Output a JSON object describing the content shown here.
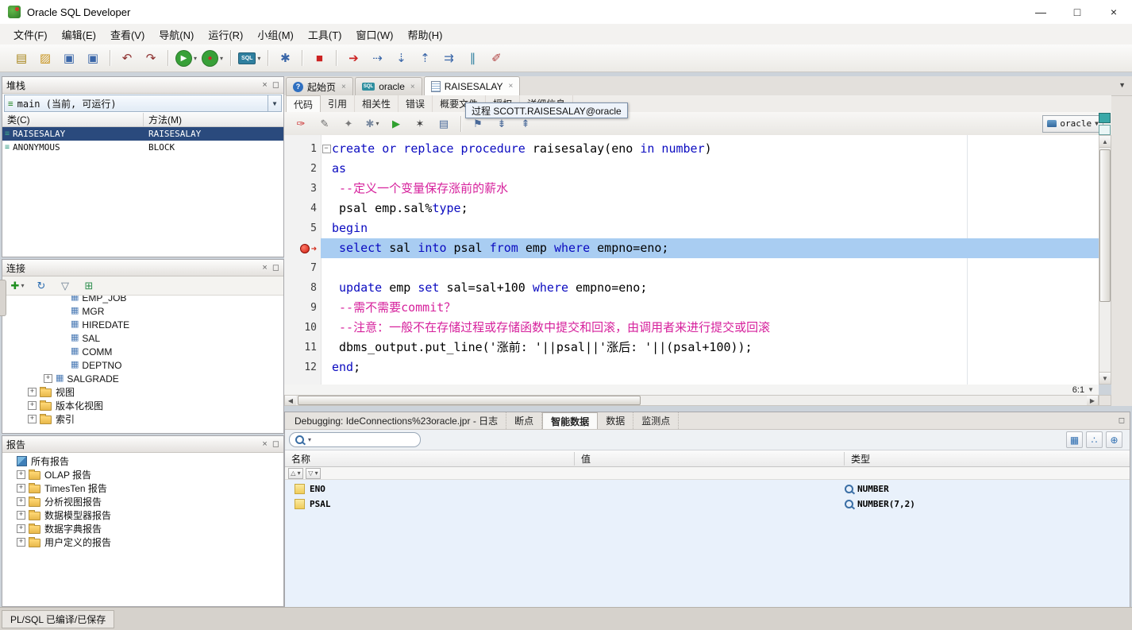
{
  "colors": {
    "selection": "#2a4a7d",
    "line_highlight": "#a9cdf2",
    "breakpoint_red": "#cf1d10",
    "keyword_blue": "#0a0ac0",
    "comment_pink": "#d6219c"
  },
  "window": {
    "title": "Oracle SQL Developer",
    "controls": [
      {
        "name": "minimize-button",
        "glyph": "—"
      },
      {
        "name": "maximize-button",
        "glyph": "□"
      },
      {
        "name": "close-button",
        "glyph": "×"
      }
    ]
  },
  "menu_bar": {
    "items": [
      "文件(F)",
      "编辑(E)",
      "查看(V)",
      "导航(N)",
      "运行(R)",
      "小组(M)",
      "工具(T)",
      "窗口(W)",
      "帮助(H)"
    ]
  },
  "main_toolbar": {
    "buttons": [
      {
        "name": "new-file-button",
        "glyph": "▤",
        "color": "#a8861c"
      },
      {
        "name": "open-button",
        "glyph": "▨",
        "color": "#c8941e"
      },
      {
        "name": "save-button",
        "glyph": "▣",
        "color": "#3a66a8"
      },
      {
        "name": "save-all-button",
        "glyph": "▣",
        "color": "#3a66a8"
      },
      {
        "sep": true
      },
      {
        "name": "undo-button",
        "glyph": "↶",
        "color": "#8d2f2f"
      },
      {
        "name": "redo-button",
        "glyph": "↷",
        "color": "#8d2f2f"
      },
      {
        "sep": true
      },
      {
        "name": "run-button",
        "glyph": "▶",
        "color": "#ffffff",
        "bg": "#38a038",
        "dropdown": true
      },
      {
        "name": "debug-button",
        "glyph": "●",
        "color": "#cc2a2a",
        "bg": "#38a038",
        "dropdown": true
      },
      {
        "sep": true
      },
      {
        "name": "sql-worksheet-button",
        "glyph": "SQL",
        "color": "#ffffff",
        "bg": "#2f7f9f",
        "dropdown": true
      },
      {
        "sep": true
      },
      {
        "name": "gears-icon",
        "glyph": "✱",
        "color": "#3a66a8"
      },
      {
        "sep": true
      },
      {
        "name": "terminate-button",
        "glyph": "■",
        "color": "#cc2222"
      },
      {
        "sep": true
      },
      {
        "name": "find-execution-point-button",
        "glyph": "➔",
        "color": "#cc2222"
      },
      {
        "name": "step-over-button",
        "glyph": "⇢",
        "color": "#3a66a8"
      },
      {
        "name": "step-into-button",
        "glyph": "⇣",
        "color": "#3a66a8"
      },
      {
        "name": "step-out-button",
        "glyph": "⇡",
        "color": "#3a66a8"
      },
      {
        "name": "resume-button",
        "glyph": "⇉",
        "color": "#3a66a8"
      },
      {
        "name": "pause-button",
        "glyph": "∥",
        "color": "#2f7f9f"
      },
      {
        "name": "run-to-cursor-button",
        "glyph": "✐",
        "color": "#b04040"
      }
    ]
  },
  "stack_panel": {
    "title": "堆栈",
    "thread": {
      "label": "main (当前, 可运行)"
    },
    "columns": [
      "类(C)",
      "方法(M)"
    ],
    "rows": [
      {
        "cls": "RAISESALAY",
        "method": "RAISESALAY",
        "selected": true
      },
      {
        "cls": "ANONYMOUS",
        "method": "BLOCK",
        "selected": false
      }
    ]
  },
  "connections_panel": {
    "title": "连接",
    "toolbar": [
      {
        "name": "add-connection-button",
        "glyph": "✚",
        "color": "#1f8f1f",
        "dropdown": true
      },
      {
        "name": "refresh-button",
        "glyph": "↻",
        "color": "#2b6cb0"
      },
      {
        "name": "filter-button",
        "glyph": "▽",
        "color": "#667a8e"
      },
      {
        "name": "collapse-all-button",
        "glyph": "⊞",
        "color": "#2f8f4f"
      }
    ],
    "tree": [
      {
        "label": "EMP_JOB",
        "icon": "column",
        "lvl": 3,
        "cut": true
      },
      {
        "label": "MGR",
        "icon": "column",
        "lvl": 3
      },
      {
        "label": "HIREDATE",
        "icon": "column",
        "lvl": 3
      },
      {
        "label": "SAL",
        "icon": "column",
        "lvl": 3
      },
      {
        "label": "COMM",
        "icon": "column",
        "lvl": 3
      },
      {
        "label": "DEPTNO",
        "icon": "column",
        "lvl": 3
      },
      {
        "label": "SALGRADE",
        "icon": "table",
        "lvl": 2,
        "expand": true
      },
      {
        "label": "视图",
        "icon": "folder",
        "lvl": 1,
        "expand": true
      },
      {
        "label": "版本化视图",
        "icon": "folder",
        "lvl": 1,
        "expand": true
      },
      {
        "label": "索引",
        "icon": "folder",
        "lvl": 1,
        "expand": true
      }
    ]
  },
  "reports_panel": {
    "title": "报告",
    "items": [
      {
        "label": "所有报告",
        "icon": "report",
        "expand": false
      },
      {
        "label": "OLAP 报告",
        "icon": "folder",
        "expand": true
      },
      {
        "label": "TimesTen 报告",
        "icon": "folder",
        "expand": true
      },
      {
        "label": "分析视图报告",
        "icon": "folder",
        "expand": true
      },
      {
        "label": "数据模型器报告",
        "icon": "folder",
        "expand": true
      },
      {
        "label": "数据字典报告",
        "icon": "folder",
        "expand": true
      },
      {
        "label": "用户定义的报告",
        "icon": "folder",
        "expand": true
      }
    ]
  },
  "editor": {
    "doc_tabs": [
      {
        "label": "起始页",
        "icon": "help",
        "active": false
      },
      {
        "label": "oracle",
        "icon": "sql",
        "active": false
      },
      {
        "label": "RAISESALAY",
        "icon": "file",
        "active": true
      }
    ],
    "sub_tabs": [
      {
        "label": "代码",
        "active": true
      },
      {
        "label": "引用",
        "active": false
      },
      {
        "label": "相关性",
        "active": false
      },
      {
        "label": "错误",
        "active": false
      },
      {
        "label": "概要文件",
        "active": false
      },
      {
        "label": "授权",
        "active": false
      },
      {
        "label": "详细信息",
        "active": false
      }
    ],
    "tooltip": "过程 SCOTT.RAISESALAY@oracle",
    "toolbar": {
      "buttons": [
        {
          "name": "debug-needle-icon",
          "glyph": "✑",
          "color": "#cc3333"
        },
        {
          "name": "edit-icon",
          "glyph": "✎",
          "color": "#6b6b6b"
        },
        {
          "name": "compile-icon",
          "glyph": "✦",
          "color": "#7a7a7a"
        },
        {
          "name": "compile-options-button",
          "glyph": "✱",
          "color": "#7a8aa0",
          "dropdown": true
        },
        {
          "name": "run-icon",
          "glyph": "▶",
          "color": "#2fa02f"
        },
        {
          "name": "debug-icon",
          "glyph": "✶",
          "color": "#404040"
        },
        {
          "name": "profile-icon",
          "glyph": "▤",
          "color": "#4a6a9a"
        },
        {
          "sep": true
        },
        {
          "name": "bookmark-icon",
          "glyph": "⚑",
          "color": "#4a6a9a"
        },
        {
          "name": "next-bookmark-icon",
          "glyph": "⇟",
          "color": "#4a6a9a"
        },
        {
          "name": "prev-bookmark-icon",
          "glyph": "⇞",
          "color": "#4a6a9a"
        }
      ],
      "connection": {
        "label": "oracle"
      }
    },
    "position": "6:1",
    "code": {
      "lines": [
        {
          "n": 1,
          "fold": true,
          "seg": [
            [
              "kw",
              "create or replace procedure "
            ],
            [
              "pl",
              "raisesalay(eno "
            ],
            [
              "kw",
              "in number"
            ],
            [
              "pl",
              ")"
            ]
          ]
        },
        {
          "n": 2,
          "seg": [
            [
              "kw",
              "as"
            ]
          ]
        },
        {
          "n": 3,
          "seg": [
            [
              "cm",
              " --定义一个变量保存涨前的薪水"
            ]
          ]
        },
        {
          "n": 4,
          "seg": [
            [
              "pl",
              " psal emp.sal%"
            ],
            [
              "kw",
              "type"
            ],
            [
              "pl",
              ";"
            ]
          ]
        },
        {
          "n": 5,
          "seg": [
            [
              "kw",
              "begin"
            ]
          ]
        },
        {
          "n": 6,
          "bp": true,
          "cur": true,
          "hl": true,
          "seg": [
            [
              "kw",
              " select"
            ],
            [
              "pl",
              " sal "
            ],
            [
              "kw",
              "into"
            ],
            [
              "pl",
              " psal "
            ],
            [
              "kw",
              "from"
            ],
            [
              "pl",
              " emp "
            ],
            [
              "kw",
              "where"
            ],
            [
              "pl",
              " empno=eno;"
            ]
          ]
        },
        {
          "n": 7,
          "seg": []
        },
        {
          "n": 8,
          "seg": [
            [
              "kw",
              " update"
            ],
            [
              "pl",
              " emp "
            ],
            [
              "kw",
              "set"
            ],
            [
              "pl",
              " sal=sal+100 "
            ],
            [
              "kw",
              "where"
            ],
            [
              "pl",
              " empno=eno;"
            ]
          ]
        },
        {
          "n": 9,
          "seg": [
            [
              "cm",
              " --需不需要commit？"
            ]
          ]
        },
        {
          "n": 10,
          "seg": [
            [
              "cm",
              " --注意：一般不在存储过程或存储函数中提交和回滚，由调用者来进行提交或回滚"
            ]
          ]
        },
        {
          "n": 11,
          "seg": [
            [
              "pl",
              " dbms_output.put_line('涨前: '||psal||'涨后: '||(psal+100));"
            ]
          ]
        },
        {
          "n": 12,
          "seg": [
            [
              "kw",
              "end"
            ],
            [
              "pl",
              ";"
            ]
          ]
        }
      ]
    }
  },
  "debug_panel": {
    "tabs": [
      {
        "label": "Debugging: IdeConnections%23oracle.jpr - 日志",
        "active": false
      },
      {
        "label": "断点",
        "active": false
      },
      {
        "label": "智能数据",
        "active": true
      },
      {
        "label": "数据",
        "active": false
      },
      {
        "label": "监测点",
        "active": false
      }
    ],
    "search": {
      "placeholder": "",
      "value": ""
    },
    "view_buttons": [
      {
        "name": "grid-view-button",
        "glyph": "▦",
        "color": "#2b6cb0"
      },
      {
        "name": "tree-view-button",
        "glyph": "∴",
        "color": "#2b6cb0"
      },
      {
        "name": "zoom-button",
        "glyph": "⊕",
        "color": "#2b6cb0"
      }
    ],
    "sort_buttons": [
      {
        "name": "sort-ascending-button",
        "glyph": "△"
      },
      {
        "name": "sort-descending-button",
        "glyph": "▽"
      }
    ],
    "columns": [
      "名称",
      "值",
      "类型"
    ],
    "rows": [
      {
        "name": "ENO",
        "value": "",
        "type": "NUMBER"
      },
      {
        "name": "PSAL",
        "value": "",
        "type": "NUMBER(7,2)"
      }
    ]
  },
  "status_bar": {
    "text": "PL/SQL 已编译/已保存"
  }
}
